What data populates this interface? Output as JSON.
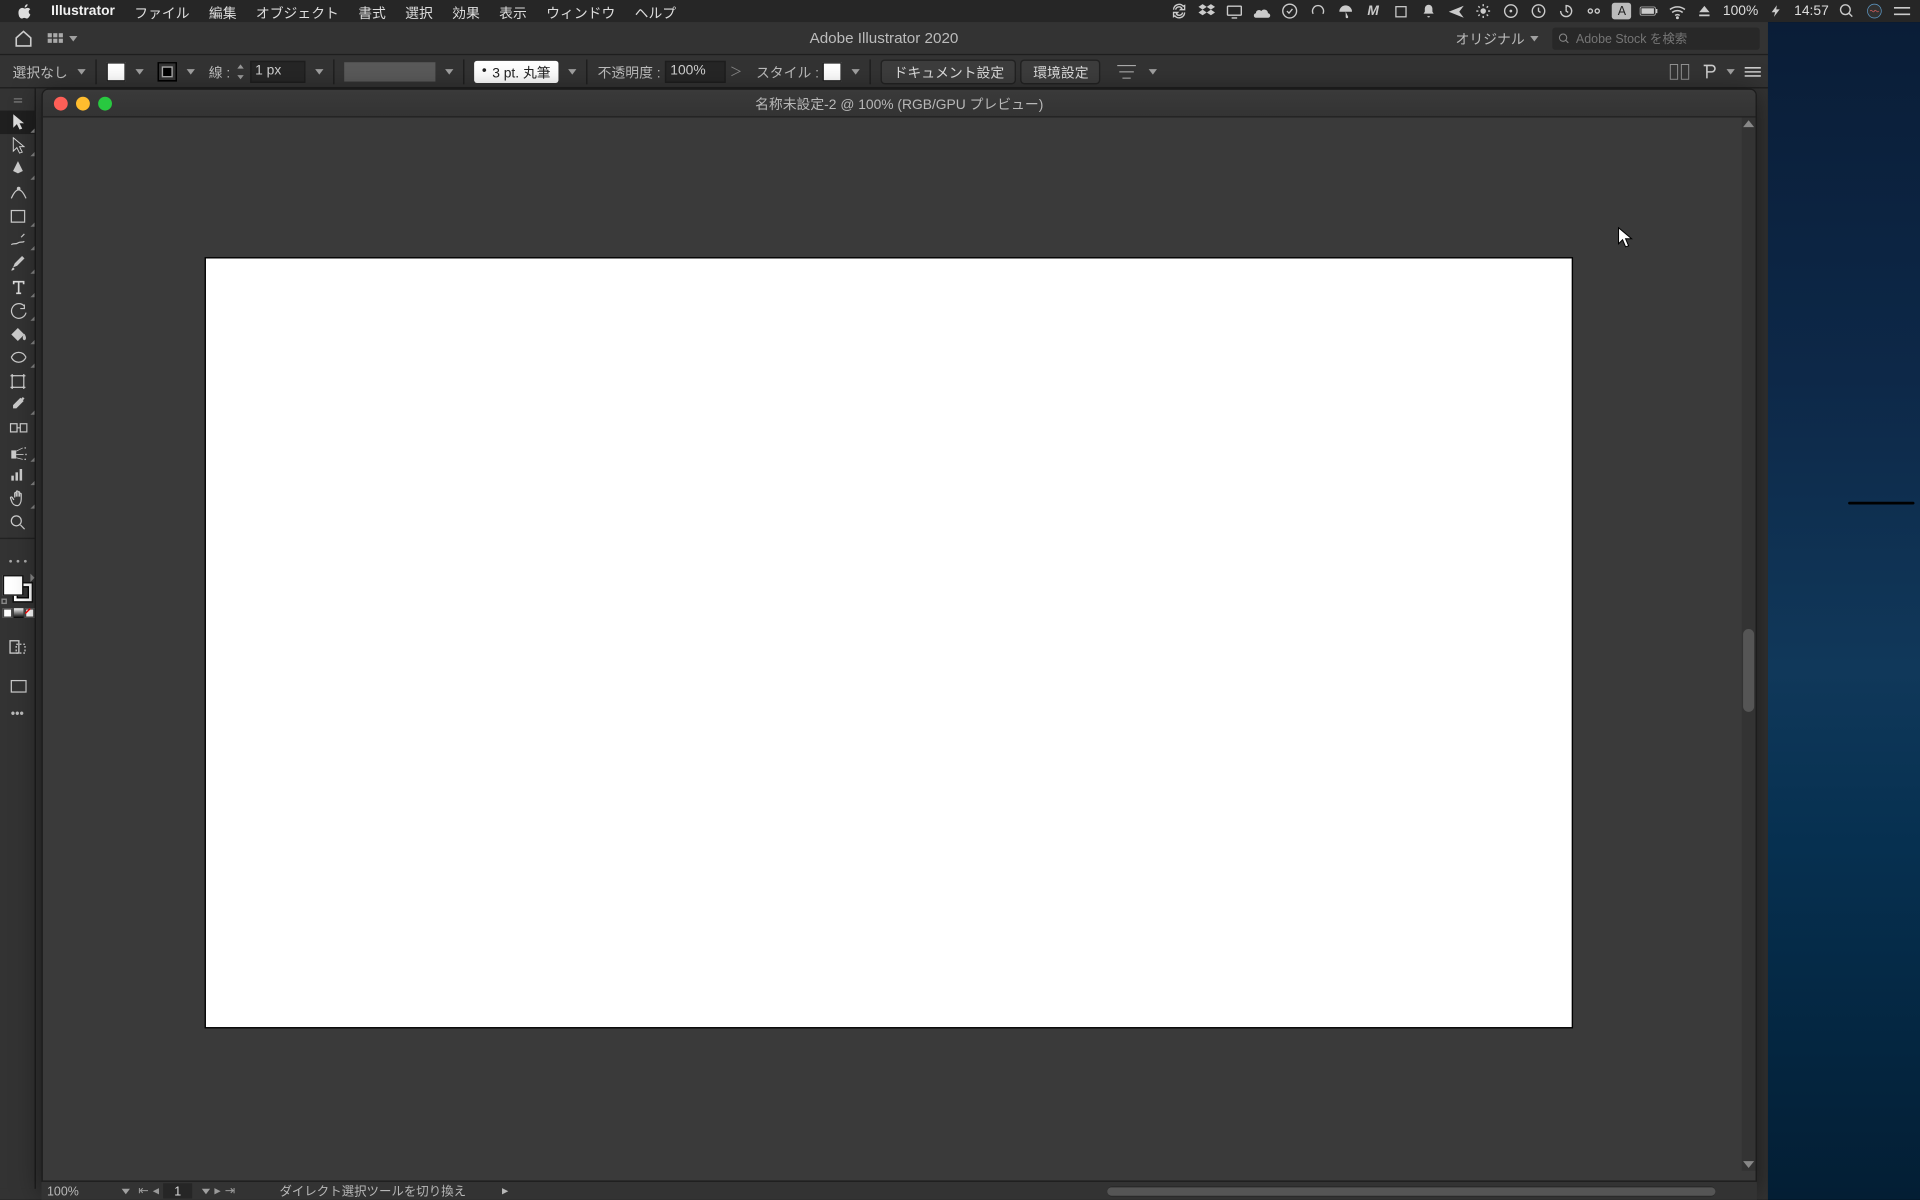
{
  "mac_menubar": {
    "app_name": "Illustrator",
    "menus": [
      "ファイル",
      "編集",
      "オブジェクト",
      "書式",
      "選択",
      "効果",
      "表示",
      "ウィンドウ",
      "ヘルプ"
    ],
    "battery_pct": "100%",
    "clock": "14:57"
  },
  "app_topbar": {
    "title": "Adobe Illustrator 2020",
    "workspace": "オリジナル",
    "search_placeholder": "Adobe Stock を検索"
  },
  "opt": {
    "selection": "選択なし",
    "stroke_label": "線 :",
    "stroke_val": "1 px",
    "brush_val": "3 pt. 丸筆",
    "opacity_label": "不透明度 :",
    "opacity_val": "100%",
    "style_label": "スタイル :",
    "btn_doc_setup": "ドキュメント設定",
    "btn_prefs": "環境設定"
  },
  "doc": {
    "title": "名称未設定-2 @ 100% (RGB/GPU プレビュー)"
  },
  "status": {
    "zoom": "100%",
    "artboard": "1",
    "tip": "ダイレクト選択ツールを切り換え"
  },
  "tools": [
    "selection",
    "direct-selection",
    "pen",
    "curvature",
    "rectangle",
    "paintbrush",
    "eraser",
    "rotate",
    "width",
    "type",
    "line-segment",
    "shape-builder",
    "eyedropper",
    "gradient",
    "symbol-sprayer",
    "column-graph",
    "artboard",
    "slice",
    "hand",
    "zoom"
  ]
}
